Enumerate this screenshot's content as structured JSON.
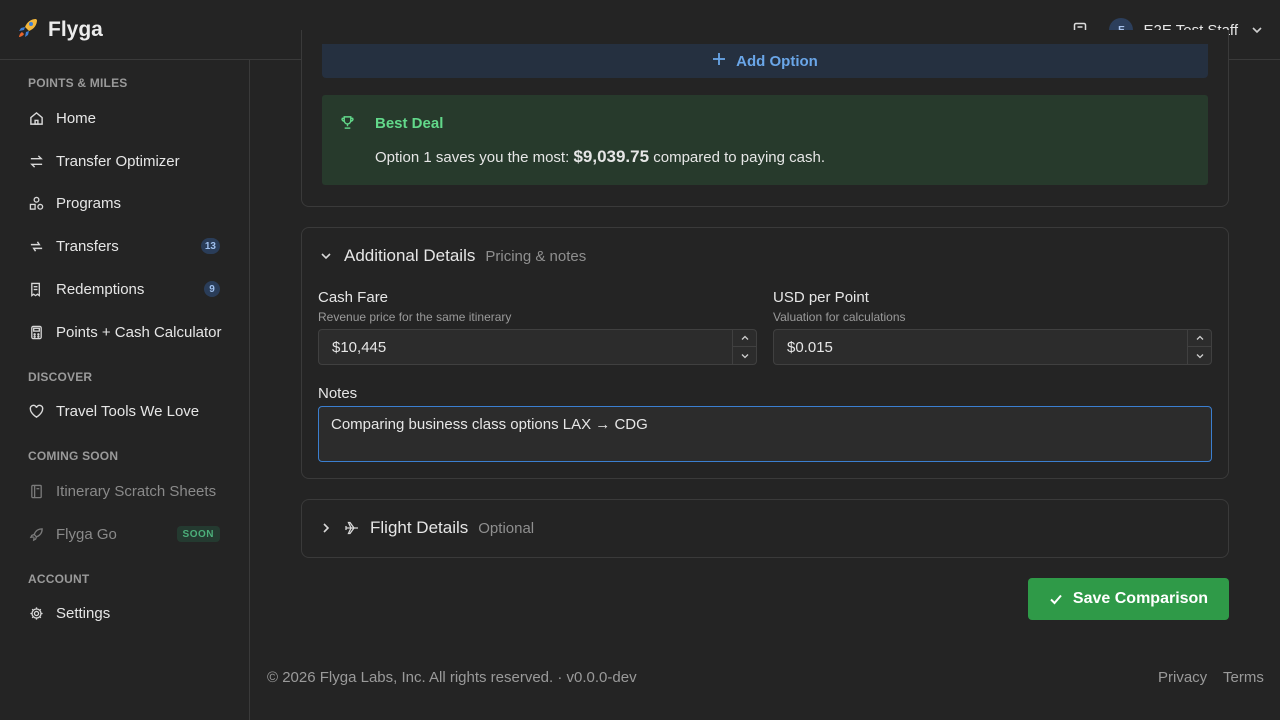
{
  "app": {
    "name": "Flyga"
  },
  "header": {
    "avatar_initial": "E",
    "user_name": "E2E Test Staff"
  },
  "sidebar": {
    "sections": {
      "points_miles": "POINTS & MILES",
      "discover": "DISCOVER",
      "coming_soon": "COMING SOON",
      "account": "ACCOUNT"
    },
    "items": {
      "home": "Home",
      "transfer_optimizer": "Transfer Optimizer",
      "programs": "Programs",
      "transfers": "Transfers",
      "transfers_badge": "13",
      "redemptions": "Redemptions",
      "redemptions_badge": "9",
      "calculator": "Points + Cash Calculator",
      "travel_tools": "Travel Tools We Love",
      "itinerary": "Itinerary Scratch Sheets",
      "flyga_go": "Flyga Go",
      "soon_badge": "SOON",
      "settings": "Settings"
    }
  },
  "main": {
    "add_option_label": "Add Option",
    "best_deal": {
      "title": "Best Deal",
      "text_before": "Option 1 saves you the most: ",
      "amount": "$9,039.75",
      "text_after": " compared to paying cash."
    },
    "additional_details": {
      "title": "Additional Details",
      "subtitle": "Pricing & notes",
      "cash_fare": {
        "label": "Cash Fare",
        "hint": "Revenue price for the same itinerary",
        "value": "$10,445"
      },
      "usd_per_point": {
        "label": "USD per Point",
        "hint": "Valuation for calculations",
        "value": "$0.015"
      },
      "notes": {
        "label": "Notes",
        "value": "Comparing business class options LAX → CDG"
      }
    },
    "flight_details": {
      "title": "Flight Details",
      "subtitle": "Optional"
    },
    "save_label": "Save Comparison"
  },
  "footer": {
    "copyright": "© 2026 Flyga Labs, Inc. All rights reserved. · v0.0.0-dev",
    "privacy": "Privacy",
    "terms": "Terms"
  },
  "colors": {
    "accent_blue": "#6aa6e8",
    "success_green": "#2f9a48",
    "best_deal_green": "#62d88a"
  }
}
